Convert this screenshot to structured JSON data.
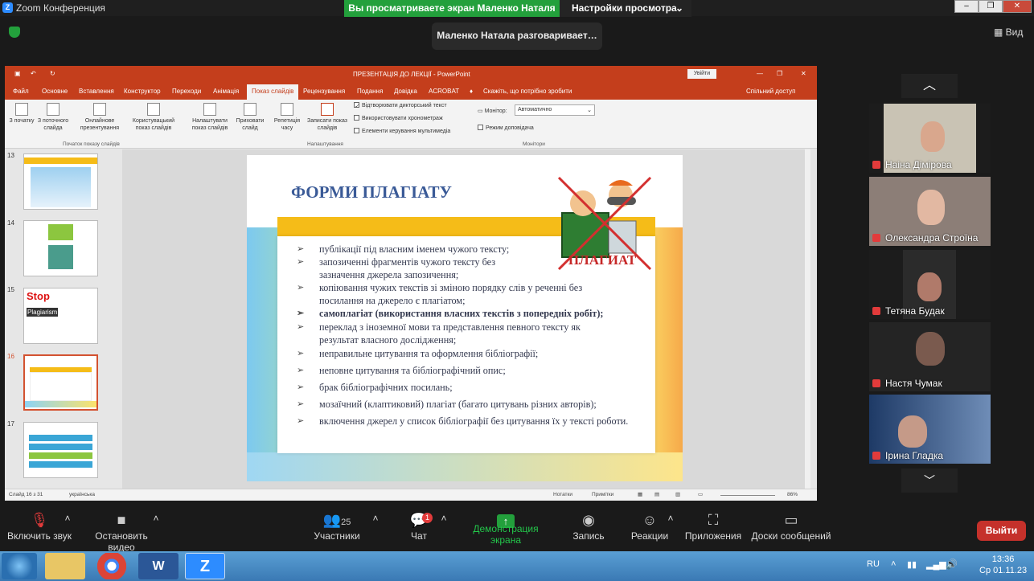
{
  "zoom": {
    "window_title": "Zoom Конференция",
    "viewing_banner": "Вы просматриваете экран Маленко Наталя",
    "view_options": "Настройки просмотра",
    "talking": "Маленко Натала разговаривает…",
    "view_button": "Вид"
  },
  "ppt": {
    "title": "ПРЕЗЕНТАЦІЯ ДО ЛЕКЦІЇ  -  PowerPoint",
    "sign_in": "Увійти",
    "tabs": [
      "Файл",
      "Основне",
      "Вставлення",
      "Конструктор",
      "Переходи",
      "Анімація",
      "Показ слайдів",
      "Рецензування",
      "Подання",
      "Довідка",
      "ACROBAT"
    ],
    "tell_me": "Скажіть, що потрібно зробити",
    "share": "Спільний доступ",
    "ribbon": {
      "from_start": "З початку",
      "from_current": "З поточного слайда",
      "online": "Онлайнове презентування",
      "custom": "Користувацький показ слайдів",
      "group1": "Початок показу слайдів",
      "setup": "Налаштувати показ слайдів",
      "hide": "Приховати слайд",
      "rehearse": "Репетиція часу",
      "record": "Записати показ слайдів",
      "opt_narration": "Відтворювати дикторський текст",
      "opt_timings": "Використовувати хронометраж",
      "opt_media": "Елементи керування мультимедіа",
      "group2": "Налаштування",
      "monitor_label": "Монітор:",
      "monitor_value": "Автоматично",
      "presenter": "Режим доповідача",
      "group3": "Монітори"
    },
    "thumb_numbers": [
      "13",
      "14",
      "15",
      "16",
      "17"
    ],
    "thumb15_text1": "Stop",
    "thumb15_text2": "Plagiarism",
    "status": {
      "slide": "Слайд 16 з 31",
      "lang": "українська",
      "notes": "Нотатки",
      "comments": "Примітки",
      "zoom": "86%"
    }
  },
  "slide": {
    "title": "ФОРМИ ПЛАГІАТУ",
    "stamp": "ПЛАГИАТ",
    "items": [
      "публікації під власним іменем чужого тексту;",
      "запозиченні фрагментів чужого тексту без зазначення джерела запозичення;",
      "копіювання чужих текстів зі зміною порядку слів у реченні без посилання на джерело є плагіатом;",
      "самоплагіат (використання власних текстів з попередніх робіт);",
      "переклад з іноземної мови та представлення певного тексту як результат власного дослідження;",
      "неправильне цитування та оформлення бібліографії;",
      "неповне цитування та бібліографічний опис;",
      "брак бібліографічних посилань;",
      "мозаїчний (клаптиковий) плагіат (багато цитувань різних авторів);",
      "включення джерел у список бібліографії без цитування їх у тексті роботи."
    ]
  },
  "participants": [
    "Наіна Дімірова",
    "Олександра Строїна",
    "Тетяна Будак",
    "Настя Чумак",
    "Ірина Гладка"
  ],
  "toolbar": {
    "mute": "Включить звук",
    "video": "Остановить видео",
    "participants": "Участники",
    "participants_count": "25",
    "chat": "Чат",
    "chat_badge": "1",
    "share": "Демонстрация экрана",
    "record": "Запись",
    "reactions": "Реакции",
    "apps": "Приложения",
    "whiteboards": "Доски сообщений",
    "leave": "Выйти"
  },
  "taskbar": {
    "lang": "RU",
    "time": "13:36",
    "date": "Ср 01.11.23"
  }
}
